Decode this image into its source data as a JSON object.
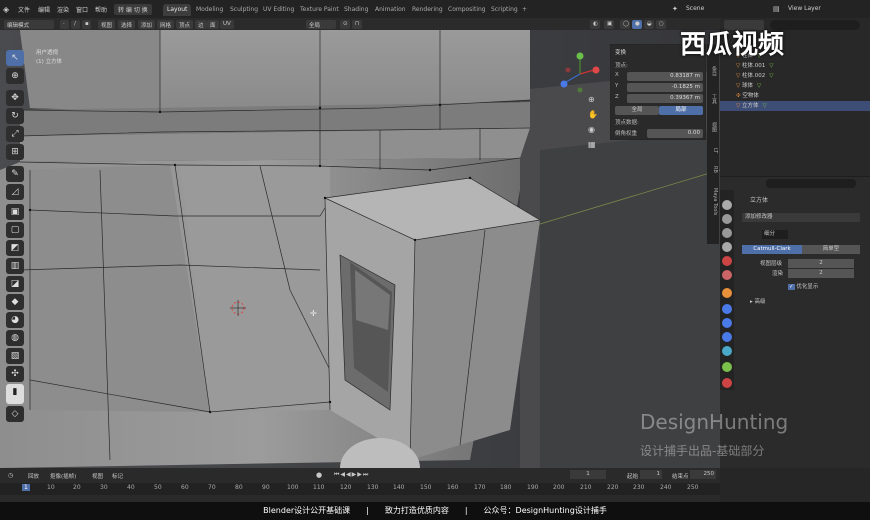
{
  "menu": [
    "文件",
    "编辑",
    "渲染",
    "窗口",
    "帮助"
  ],
  "editor_switch": "转 编 切 换",
  "workspaces": [
    "Layout",
    "Modeling",
    "Sculpting",
    "UV Editing",
    "Texture Paint",
    "Shading",
    "Animation",
    "Rendering",
    "Compositing",
    "Scripting",
    "+"
  ],
  "active_workspace": "Layout",
  "scene_name": "Scene",
  "view_layer": "View Layer",
  "header": {
    "mode": "编辑模式",
    "menus": [
      "视图",
      "选择",
      "添加",
      "网格",
      "顶点",
      "边",
      "面",
      "UV"
    ],
    "transform_orient": "全局"
  },
  "viewport": {
    "view_name": "用户透视",
    "object_label": "(1) 立方体"
  },
  "npanel": {
    "title": "变换",
    "vertex_label": "顶点:",
    "x_label": "X",
    "x_value": "0.83187 m",
    "y_label": "Y",
    "y_value": "-0.1825 m",
    "z_label": "Z",
    "z_value": "0.39367 m",
    "btn_global": "全局",
    "btn_local": "局部",
    "weight_label": "顶点数据:",
    "bevel_label": "倒角权重",
    "bevel_value": "0.00",
    "tabs": [
      "条目",
      "工具",
      "视图",
      "LT",
      "RB",
      "Maya Tools"
    ]
  },
  "outliner": {
    "items": [
      {
        "name": "柱体"
      },
      {
        "name": "柱体.001"
      },
      {
        "name": "柱体.002"
      },
      {
        "name": "球体"
      },
      {
        "name": "空物体"
      },
      {
        "name": "立方体",
        "selected": true
      }
    ]
  },
  "properties": {
    "object": "立方体",
    "add_modifier": "添加修改器",
    "modifier_name": "细分",
    "btn_catmull": "Catmull-Clark",
    "btn_simple": "简单型",
    "levels_viewport_label": "视图层级",
    "levels_viewport": "2",
    "render_label": "渲染",
    "render_value": "2",
    "optimal_label": "优化显示",
    "advanced_label": "高级"
  },
  "timeline": {
    "menus": [
      "回放",
      "抠像(插帧)",
      "视图",
      "标记"
    ],
    "current_frame": "1",
    "start_label": "起始",
    "start": "1",
    "end_label": "结束点",
    "end": "250",
    "scale": [
      "1",
      "10",
      "20",
      "30",
      "40",
      "50",
      "60",
      "70",
      "80",
      "90",
      "100",
      "110",
      "120",
      "130",
      "140",
      "150",
      "160",
      "170",
      "180",
      "190",
      "200",
      "210",
      "220",
      "230",
      "240",
      "250"
    ]
  },
  "subtitle": "Blender设计公开基础课　　|　　致力打造优质内容　　|　　公众号：DesignHunting设计捕手",
  "watermark_en": "DesignHunting",
  "watermark_cn": "设计捕手出品-基础部分",
  "logo_text": "西瓜视频",
  "colors": {
    "accent": "#4f6fa8",
    "selection": "#3d4d75",
    "viewport_bg": "#3b3c3f",
    "panel": "#2b2b2b"
  }
}
